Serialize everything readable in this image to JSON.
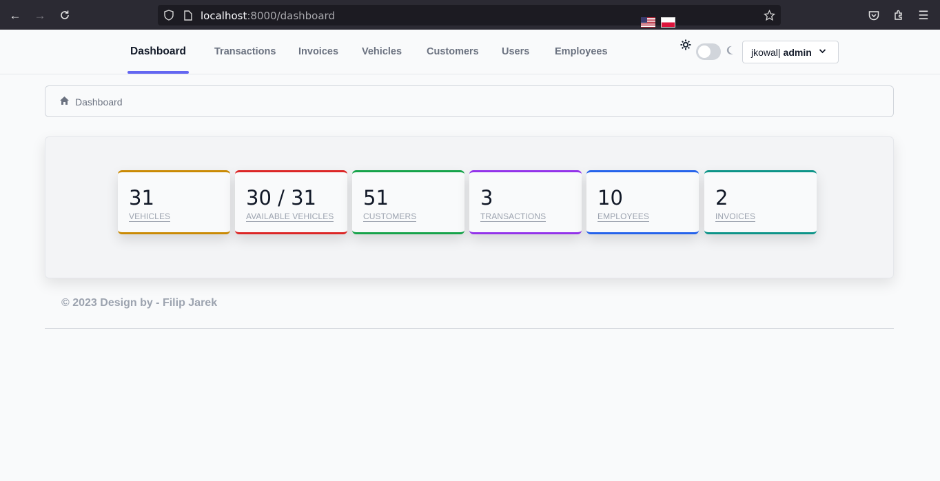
{
  "browser": {
    "url_host": "localhost",
    "url_path": ":8000/dashboard"
  },
  "nav": {
    "items": [
      {
        "label": "Dashboard",
        "active": true
      },
      {
        "label": "Transactions"
      },
      {
        "label": "Invoices"
      },
      {
        "label": "Vehicles"
      },
      {
        "label": "Customers"
      },
      {
        "label": "Users"
      },
      {
        "label": "Employees"
      }
    ],
    "accent": "#6366f1"
  },
  "languages": [
    "en-us-flag",
    "pl-flag"
  ],
  "theme_toggle": {
    "state": "light"
  },
  "user": {
    "username": "jkowal",
    "separator": " |",
    "role": "admin"
  },
  "breadcrumb": {
    "label": "Dashboard"
  },
  "stats": [
    {
      "value": "31",
      "label": "VEHICLES",
      "color": "#ca8a04"
    },
    {
      "value": "30 / 31",
      "label": "AVAILABLE VEHICLES",
      "color": "#dc2626"
    },
    {
      "value": "51",
      "label": "CUSTOMERS",
      "color": "#16a34a"
    },
    {
      "value": "3",
      "label": "TRANSACTIONS",
      "color": "#9333ea"
    },
    {
      "value": "10",
      "label": "EMPLOYEES",
      "color": "#2563eb"
    },
    {
      "value": "2",
      "label": "INVOICES",
      "color": "#0d9488"
    }
  ],
  "footer": {
    "text": "© 2023 Design by - Filip Jarek"
  }
}
